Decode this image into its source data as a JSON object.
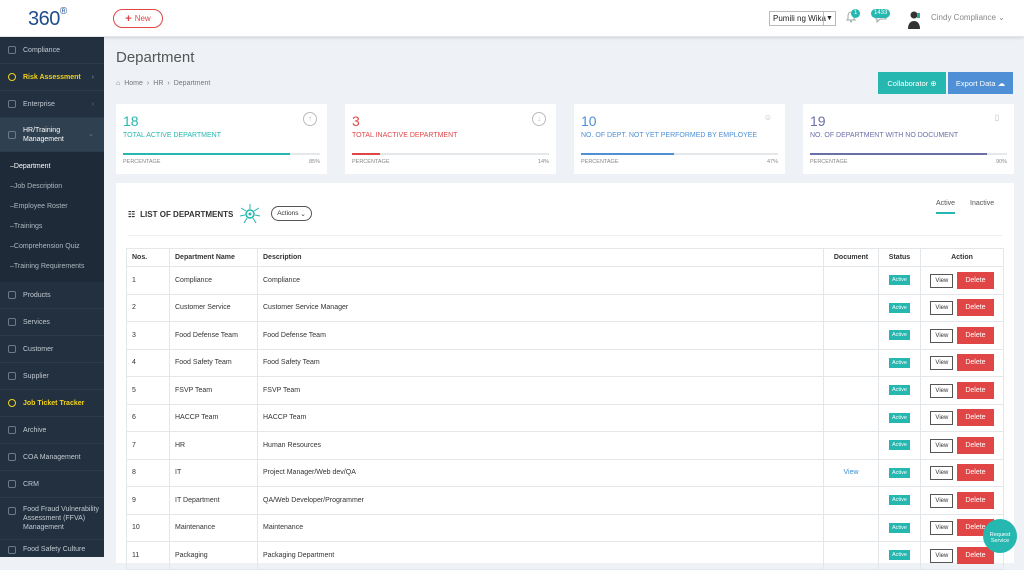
{
  "app": {
    "logo": "360",
    "logo_mark": "®"
  },
  "topbar": {
    "new_label": "New",
    "language": "Pumili ng Wika",
    "notif_count": "1",
    "msg_count": "1433",
    "user_name": "Cindy Compliance"
  },
  "sidebar": {
    "items": [
      {
        "label": "Compliance",
        "icon": "compliance-icon"
      },
      {
        "label": "Risk Assessment",
        "icon": "risk-icon"
      },
      {
        "label": "Enterprise",
        "icon": "enterprise-icon"
      },
      {
        "label": "HR/Training Management",
        "icon": "hr-icon"
      },
      {
        "label": "Products",
        "icon": "products-icon"
      },
      {
        "label": "Services",
        "icon": "services-icon"
      },
      {
        "label": "Customer",
        "icon": "customer-icon"
      },
      {
        "label": "Supplier",
        "icon": "supplier-icon"
      },
      {
        "label": "Job Ticket Tracker",
        "icon": "job-ticket-icon"
      },
      {
        "label": "Archive",
        "icon": "archive-icon"
      },
      {
        "label": "COA Management",
        "icon": "coa-icon"
      },
      {
        "label": "CRM",
        "icon": "crm-icon"
      },
      {
        "label": "Food Fraud Vulnerability Assessment (FFVA) Management",
        "icon": "ffva-icon"
      },
      {
        "label": "Food Safety Culture",
        "icon": "food-safety-icon"
      }
    ],
    "subitems": [
      "Department",
      "Job Description",
      "Employee Roster",
      "Trainings",
      "Comprehension Quiz",
      "Training Requirements"
    ]
  },
  "page": {
    "title": "Department",
    "breadcrumb": [
      "Home",
      "HR",
      "Department"
    ],
    "collaborator": "Collaborator",
    "export": "Export Data"
  },
  "cards": [
    {
      "value": "18",
      "label": "TOTAL ACTIVE DEPARTMENT",
      "pct_label": "PERCENTAGE",
      "pct": "85%",
      "fraction": 0.85,
      "color": "#26b7b0"
    },
    {
      "value": "3",
      "label": "TOTAL INACTIVE DEPARTMENT",
      "pct_label": "PERCENTAGE",
      "pct": "14%",
      "fraction": 0.14,
      "color": "#e04646"
    },
    {
      "value": "10",
      "label": "NO. OF DEPT. NOT YET PERFORMED BY EMPLOYEE",
      "pct_label": "PERCENTAGE",
      "pct": "47%",
      "fraction": 0.47,
      "color": "#4e8fd6"
    },
    {
      "value": "19",
      "label": "NO. OF DEPARTMENT WITH NO DOCUMENT",
      "pct_label": "PERCENTAGE",
      "pct": "90%",
      "fraction": 0.9,
      "color": "#6b6fa8"
    }
  ],
  "list": {
    "title": "LIST OF DEPARTMENTS",
    "actions": "Actions",
    "tab_active": "Active",
    "tab_inactive": "Inactive",
    "headers": [
      "Nos.",
      "Department Name",
      "Description",
      "Document",
      "Status",
      "Action"
    ],
    "view_label": "View",
    "delete_label": "Delete",
    "status_label": "Active",
    "doc_link": "View",
    "rows": [
      {
        "no": "1",
        "name": "Compliance",
        "desc": "Compliance",
        "doc": ""
      },
      {
        "no": "2",
        "name": "Customer Service",
        "desc": "Customer Service Manager",
        "doc": ""
      },
      {
        "no": "3",
        "name": "Food Defense Team",
        "desc": "Food Defense Team",
        "doc": ""
      },
      {
        "no": "4",
        "name": "Food Safety Team",
        "desc": "Food Safety Team",
        "doc": ""
      },
      {
        "no": "5",
        "name": "FSVP Team",
        "desc": "FSVP Team",
        "doc": ""
      },
      {
        "no": "6",
        "name": "HACCP Team",
        "desc": "HACCP Team",
        "doc": ""
      },
      {
        "no": "7",
        "name": "HR",
        "desc": "Human Resources",
        "doc": ""
      },
      {
        "no": "8",
        "name": "IT",
        "desc": "Project Manager/Web dev/QA",
        "doc": "View"
      },
      {
        "no": "9",
        "name": "IT Department",
        "desc": "QA/Web Developer/Programmer",
        "doc": ""
      },
      {
        "no": "10",
        "name": "Maintenance",
        "desc": "Maintenance",
        "doc": ""
      },
      {
        "no": "11",
        "name": "Packaging",
        "desc": "Packaging Department",
        "doc": ""
      }
    ]
  },
  "request_service": "Request Service"
}
